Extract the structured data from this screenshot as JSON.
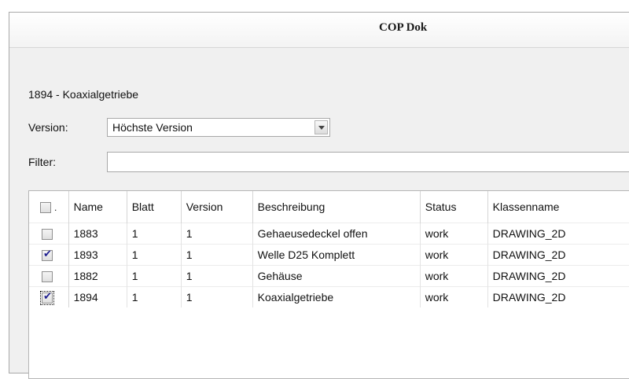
{
  "window": {
    "title": "COP Dok"
  },
  "document": {
    "title": "1894 - Koaxialgetriebe"
  },
  "version_field": {
    "label": "Version:",
    "value": "Höchste Version"
  },
  "filter_field": {
    "label": "Filter:",
    "value": "",
    "placeholder": ""
  },
  "table": {
    "header_marker": ".",
    "columns": [
      "Name",
      "Blatt",
      "Version",
      "Beschreibung",
      "Status",
      "Klassenname"
    ],
    "rows": [
      {
        "checked": false,
        "cells": [
          "1883",
          "1",
          "1",
          "Gehaeusedeckel offen",
          "work",
          "DRAWING_2D"
        ]
      },
      {
        "checked": true,
        "cells": [
          "1893",
          "1",
          "1",
          "Welle D25 Komplett",
          "work",
          "DRAWING_2D"
        ]
      },
      {
        "checked": false,
        "cells": [
          "1882",
          "1",
          "1",
          "Gehäuse",
          "work",
          "DRAWING_2D"
        ]
      },
      {
        "checked": true,
        "cells": [
          "1894",
          "1",
          "1",
          "Koaxialgetriebe",
          "work",
          "DRAWING_2D"
        ]
      }
    ]
  },
  "colors": {
    "highlight": "#fbfb4b",
    "window_bg": "#f0f0f0"
  },
  "icons": {
    "dropdown": "chevron-down-icon",
    "checkbox": "checkbox-icon"
  }
}
